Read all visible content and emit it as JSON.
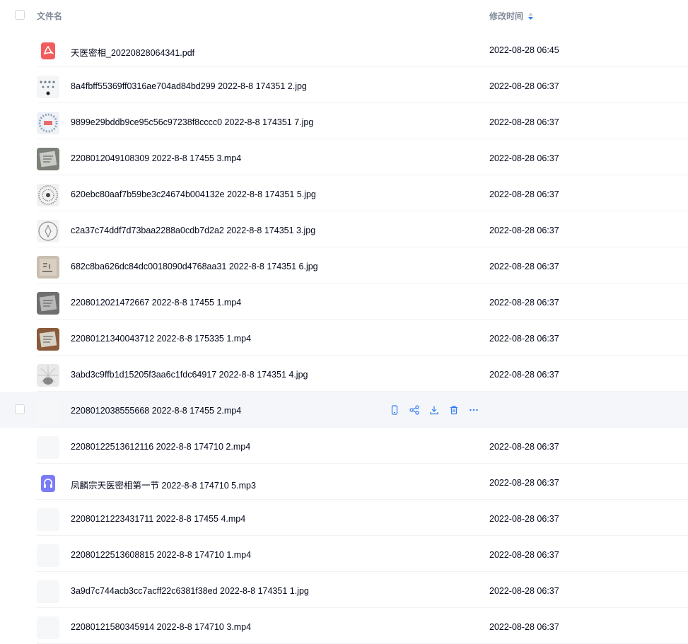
{
  "header": {
    "name_label": "文件名",
    "time_label": "修改时间"
  },
  "colors": {
    "accent": "#2f7df6",
    "pdf": "#f25c5c",
    "audio": "#7b7cf5",
    "text": "#03081a",
    "muted": "#818999"
  },
  "files": [
    {
      "name": "天医密相_20220828064341.pdf",
      "time": "2022-08-28 06:45",
      "thumb": "pdf-file-icon"
    },
    {
      "name": "8a4fbff55369ff0316ae704ad84bd299 2022-8-8 174351 2.jpg",
      "time": "2022-08-28 06:37",
      "thumb": "image-thumbnail"
    },
    {
      "name": "9899e29bddb9ce95c56c97238f8cccc0 2022-8-8 174351 7.jpg",
      "time": "2022-08-28 06:37",
      "thumb": "image-thumbnail"
    },
    {
      "name": "2208012049108309 2022-8-8 17455 3.mp4",
      "time": "2022-08-28 06:37",
      "thumb": "video-thumbnail"
    },
    {
      "name": "620ebc80aaf7b59be3c24674b004132e 2022-8-8 174351 5.jpg",
      "time": "2022-08-28 06:37",
      "thumb": "image-thumbnail"
    },
    {
      "name": "c2a37c74ddf7d73baa2288a0cdb7d2a2 2022-8-8 174351 3.jpg",
      "time": "2022-08-28 06:37",
      "thumb": "image-thumbnail"
    },
    {
      "name": "682c8ba626dc84dc0018090d4768aa31 2022-8-8 174351 6.jpg",
      "time": "2022-08-28 06:37",
      "thumb": "image-thumbnail"
    },
    {
      "name": "2208012021472667 2022-8-8 17455 1.mp4",
      "time": "2022-08-28 06:37",
      "thumb": "video-thumbnail"
    },
    {
      "name": "22080121340043712 2022-8-8 175335 1.mp4",
      "time": "2022-08-28 06:37",
      "thumb": "video-thumbnail"
    },
    {
      "name": "3abd3c9ffb1d15205f3aa6c1fdc64917 2022-8-8 174351 4.jpg",
      "time": "2022-08-28 06:37",
      "thumb": "image-thumbnail"
    },
    {
      "name": "2208012038555668 2022-8-8 17455 2.mp4",
      "time": "",
      "thumb": "blank-thumbnail",
      "hovered": true
    },
    {
      "name": "22080122513612116 2022-8-8 174710 2.mp4",
      "time": "2022-08-28 06:37",
      "thumb": "blank-thumbnail"
    },
    {
      "name": "凤麟宗天医密相第一节 2022-8-8 174710 5.mp3",
      "time": "2022-08-28 06:37",
      "thumb": "audio-file-icon"
    },
    {
      "name": "22080121223431711 2022-8-8 17455 4.mp4",
      "time": "2022-08-28 06:37",
      "thumb": "blank-thumbnail"
    },
    {
      "name": "22080122513608815 2022-8-8 174710 1.mp4",
      "time": "2022-08-28 06:37",
      "thumb": "blank-thumbnail"
    },
    {
      "name": "3a9d7c744acb3cc7acff22c6381f38ed 2022-8-8 174351 1.jpg",
      "time": "2022-08-28 06:37",
      "thumb": "blank-thumbnail"
    },
    {
      "name": "22080121580345914 2022-8-8 174710 3.mp4",
      "time": "2022-08-28 06:37",
      "thumb": "blank-thumbnail"
    }
  ],
  "row_actions": [
    "phone-icon",
    "share-icon",
    "download-icon",
    "delete-icon",
    "more-icon"
  ]
}
